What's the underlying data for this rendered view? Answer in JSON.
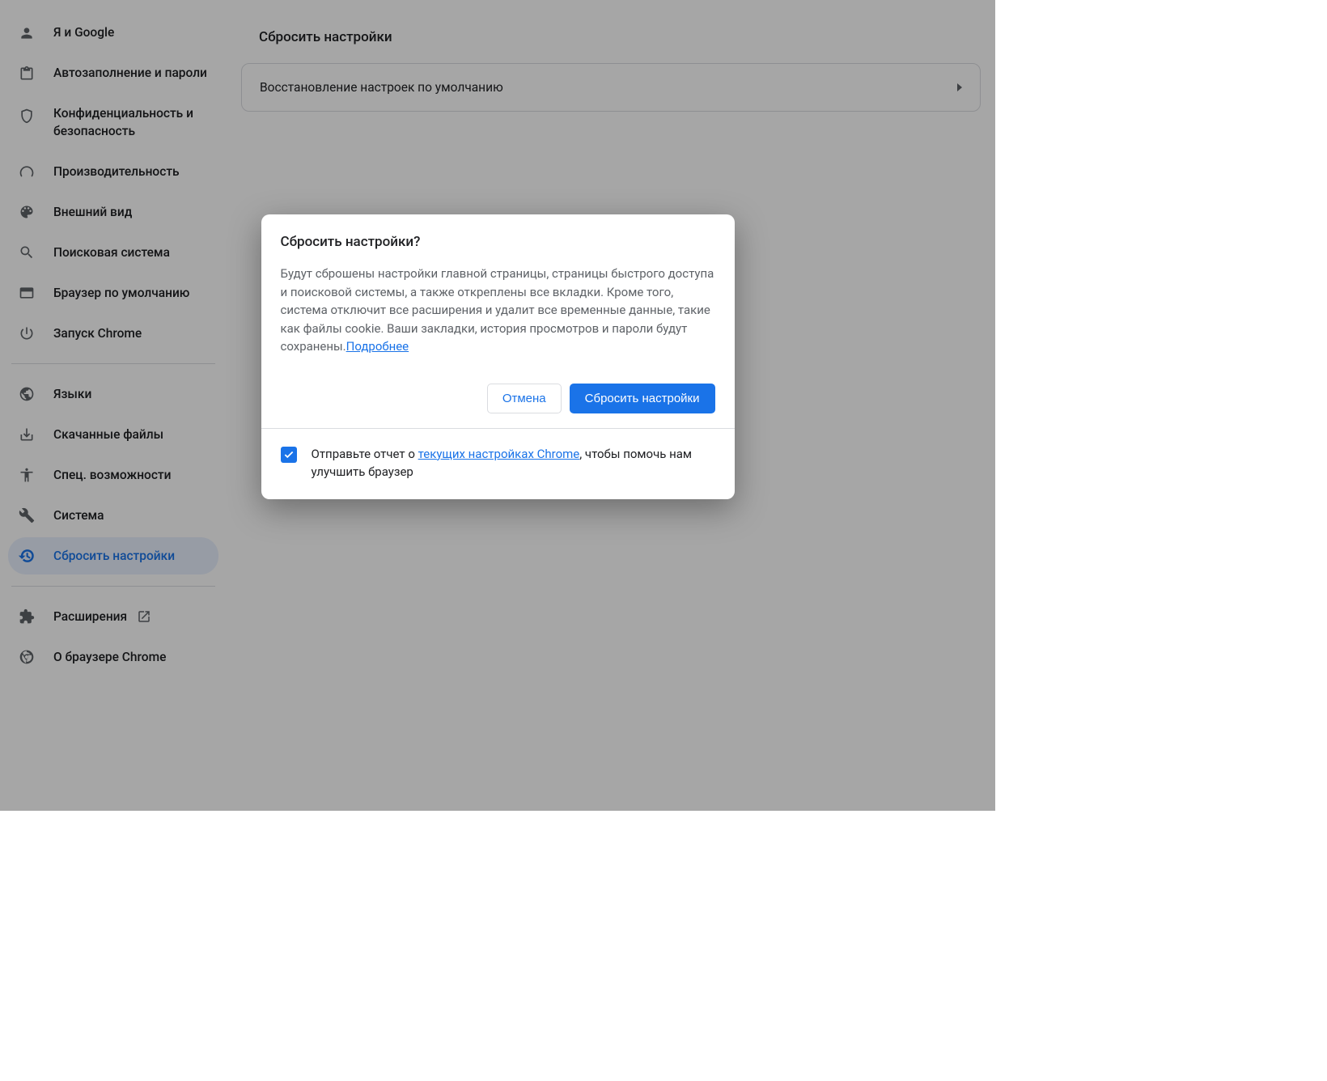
{
  "sidebar": {
    "items": [
      {
        "label": "Я и Google"
      },
      {
        "label": "Автозаполнение и пароли"
      },
      {
        "label": "Конфиденциальность и безопасность"
      },
      {
        "label": "Производительность"
      },
      {
        "label": "Внешний вид"
      },
      {
        "label": "Поисковая система"
      },
      {
        "label": "Браузер по умолчанию"
      },
      {
        "label": "Запуск Chrome"
      }
    ],
    "advanced": [
      {
        "label": "Языки"
      },
      {
        "label": "Скачанные файлы"
      },
      {
        "label": "Спец. возможности"
      },
      {
        "label": "Система"
      },
      {
        "label": "Сбросить настройки"
      }
    ],
    "bottom": [
      {
        "label": "Расширения"
      },
      {
        "label": "О браузере Chrome"
      }
    ]
  },
  "main": {
    "section_title": "Сбросить настройки",
    "row_label": "Восстановление настроек по умолчанию"
  },
  "dialog": {
    "title": "Сбросить настройки?",
    "body_text": "Будут сброшены настройки главной страницы, страницы быстрого доступа и поисковой системы, а также откреплены все вкладки. Кроме того, система отключит все расширения и удалит все временные данные, такие как файлы cookie. Ваши закладки, история просмотров и пароли будут сохранены.",
    "learn_more": "Подробнее",
    "cancel": "Отмена",
    "confirm": "Сбросить настройки",
    "footer_prefix": "Отправьте отчет о ",
    "footer_link": "текущих настройках Chrome",
    "footer_suffix": ", чтобы помочь нам улучшить браузер"
  }
}
